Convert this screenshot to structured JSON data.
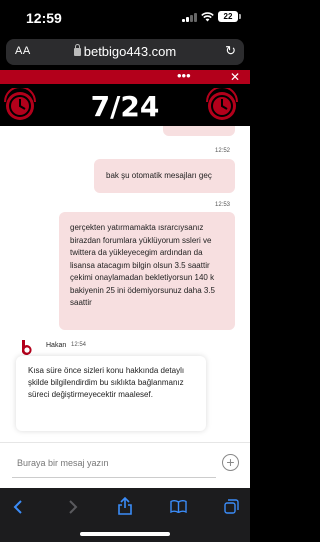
{
  "status_bar": {
    "time": "12:59",
    "battery": "22"
  },
  "browser": {
    "text_size_label": "AA",
    "url": "betbigo443.com"
  },
  "widget": {
    "menu_glyph": "•••",
    "close_glyph": "✕",
    "banner_title": "7/24"
  },
  "chat": {
    "messages": [
      {
        "time": "12:52",
        "text": "bak şu otomatik mesajları geç"
      },
      {
        "time": "12:53",
        "text": "gerçekten yatırmamakta ısrarcıysanız birazdan forumlara yüklüyorum ssleri ve twittera da yükleyecegim ardından da lisansa atacagım bilgin olsun 3.5 saattir çekimi onaylamadan bekletiyorsun 140 k bakiyenin 25 ini ödemiyorsunuz daha 3.5 saattir"
      }
    ],
    "agent_reply": {
      "name": "Hakan",
      "time": "12:54",
      "text": "Kısa süre önce sizleri konu hakkında detaylı şkilde bilgilendirdim bu sıklıkta bağlanmanız süreci değiştirmeyecektir maalesef."
    }
  },
  "input": {
    "placeholder": "Buraya bir mesaj yazın"
  },
  "colors": {
    "brand_red": "#b3001b",
    "user_bubble": "#f7dfe0",
    "ios_blue": "#3b8cf8"
  }
}
